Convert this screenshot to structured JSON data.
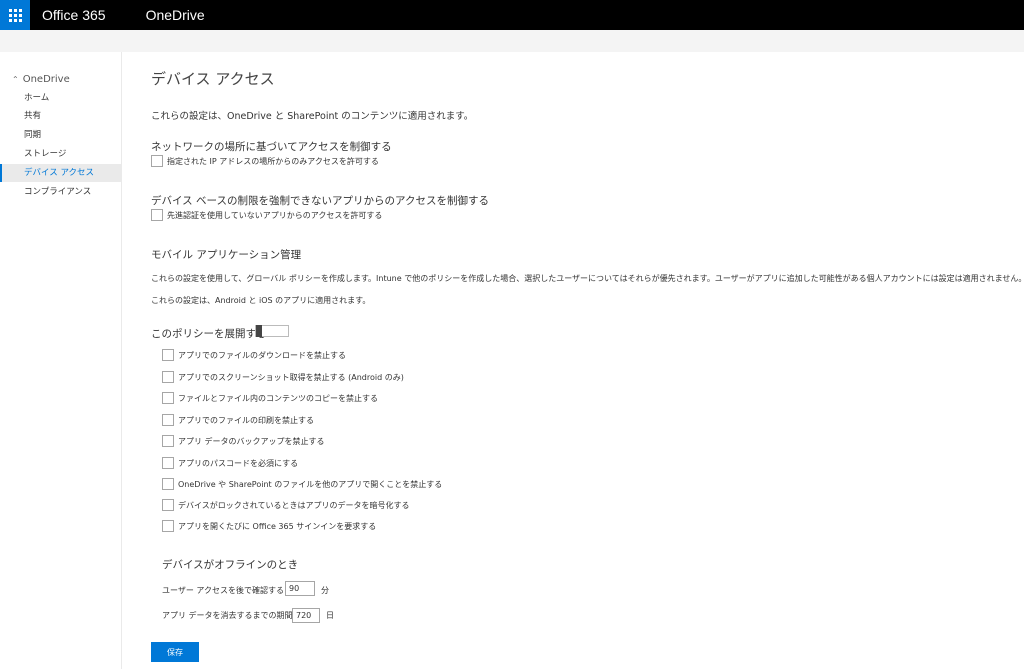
{
  "suite": {
    "brand": "Office 365",
    "app_name": "OneDrive",
    "launcher_icon": "waffle-icon"
  },
  "nav": {
    "root": "OneDrive",
    "items": [
      {
        "label": "ホーム",
        "active": false
      },
      {
        "label": "共有",
        "active": false
      },
      {
        "label": "同期",
        "active": false
      },
      {
        "label": "ストレージ",
        "active": false
      },
      {
        "label": "デバイス アクセス",
        "active": true
      },
      {
        "label": "コンプライアンス",
        "active": false
      }
    ]
  },
  "page": {
    "title": "デバイス アクセス",
    "intro": "これらの設定は、OneDrive と SharePoint のコンテンツに適用されます。",
    "network": {
      "heading": "ネットワークの場所に基づいてアクセスを制御する",
      "checkbox": "指定された IP アドレスの場所からのみアクセスを許可する"
    },
    "device_based": {
      "heading": "デバイス ベースの制限を強制できないアプリからのアクセスを制御する",
      "checkbox": "先進認証を使用していないアプリからのアクセスを許可する"
    },
    "mam": {
      "heading": "モバイル アプリケーション管理",
      "description1": "これらの設定を使用して、グローバル ポリシーを作成します。Intune で他のポリシーを作成した場合、選択したユーザーについてはそれらが優先されます。ユーザーがアプリに追加した可能性がある個人アカウントには設定は適用されません。",
      "description2": "これらの設定は、Android と iOS のアプリに適用されます。",
      "deploy_label": "このポリシーを展開する",
      "deploy_on": false,
      "options": [
        "アプリでのファイルのダウンロードを禁止する",
        "アプリでのスクリーンショット取得を禁止する (Android のみ)",
        "ファイルとファイル内のコンテンツのコピーを禁止する",
        "アプリでのファイルの印刷を禁止する",
        "アプリ データのバックアップを禁止する",
        "アプリのパスコードを必須にする",
        "OneDrive や SharePoint のファイルを他のアプリで開くことを禁止する",
        "デバイスがロックされているときはアプリのデータを暗号化する",
        "アプリを開くたびに Office 365 サインインを要求する"
      ]
    },
    "offline": {
      "heading": "デバイスがオフラインのとき",
      "recheck_label": "ユーザー アクセスを後で確認する",
      "recheck_value": "90",
      "recheck_unit": "分",
      "wipe_label": "アプリ データを消去するまでの期間",
      "wipe_value": "720",
      "wipe_unit": "日"
    },
    "save_label": "保存"
  }
}
